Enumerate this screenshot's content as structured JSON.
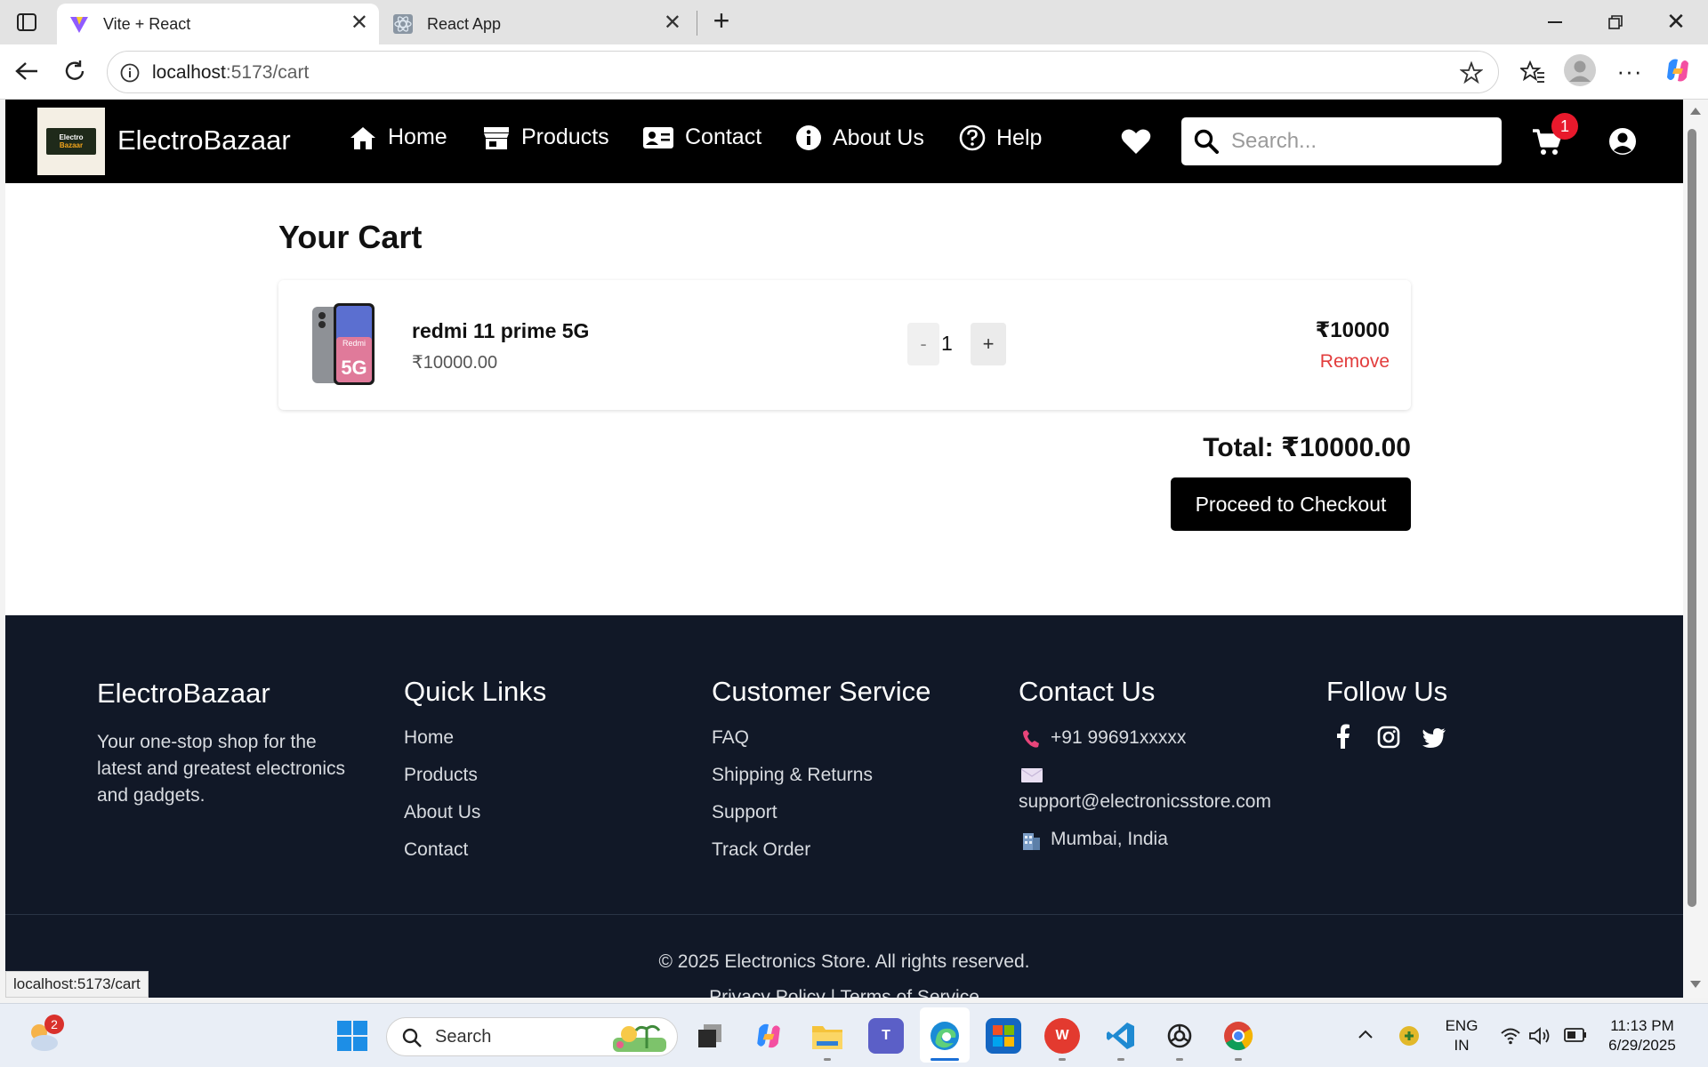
{
  "browser": {
    "tabs": [
      {
        "title": "Vite + React",
        "active": true
      },
      {
        "title": "React App",
        "active": false
      }
    ],
    "url_host": "localhost",
    "url_path": ":5173/cart",
    "status_url": "localhost:5173/cart"
  },
  "nav": {
    "brand": "ElectroBazaar",
    "logo_line1": "Electro",
    "logo_line2": "Bazaar",
    "links": [
      "Home",
      "Products",
      "Contact",
      "About Us",
      "Help"
    ],
    "search_placeholder": "Search...",
    "cart_count": "1"
  },
  "cart": {
    "title": "Your Cart",
    "item": {
      "name": "redmi 11 prime 5G",
      "unit_price": "₹10000.00",
      "quantity": "1",
      "line_total": "₹10000",
      "remove_label": "Remove",
      "decrement_label": "-",
      "increment_label": "+"
    },
    "total": "Total: ₹10000.00",
    "checkout_label": "Proceed to Checkout"
  },
  "footer": {
    "brand": "ElectroBazaar",
    "tagline": "Your one-stop shop for the latest and greatest electronics and gadgets.",
    "quick_links_title": "Quick Links",
    "quick_links": [
      "Home",
      "Products",
      "About Us",
      "Contact"
    ],
    "customer_service_title": "Customer Service",
    "customer_service": [
      "FAQ",
      "Shipping & Returns",
      "Support",
      "Track Order"
    ],
    "contact_title": "Contact Us",
    "contact_phone": "+91 99691xxxxx",
    "contact_email": "support@electronicsstore.com",
    "contact_location": "Mumbai, India",
    "follow_title": "Follow Us",
    "copyright": "© 2025 Electronics Store. All rights reserved.",
    "policy": "Privacy Policy | Terms of Service"
  },
  "taskbar": {
    "search_label": "Search",
    "weather_badge": "2",
    "lang_line1": "ENG",
    "lang_line2": "IN",
    "time": "11:13 PM",
    "date": "6/29/2025"
  },
  "colors": {
    "nav_bg": "#000000",
    "footer_bg": "#111827",
    "remove": "#e23c3c",
    "badge": "#e8192c"
  }
}
